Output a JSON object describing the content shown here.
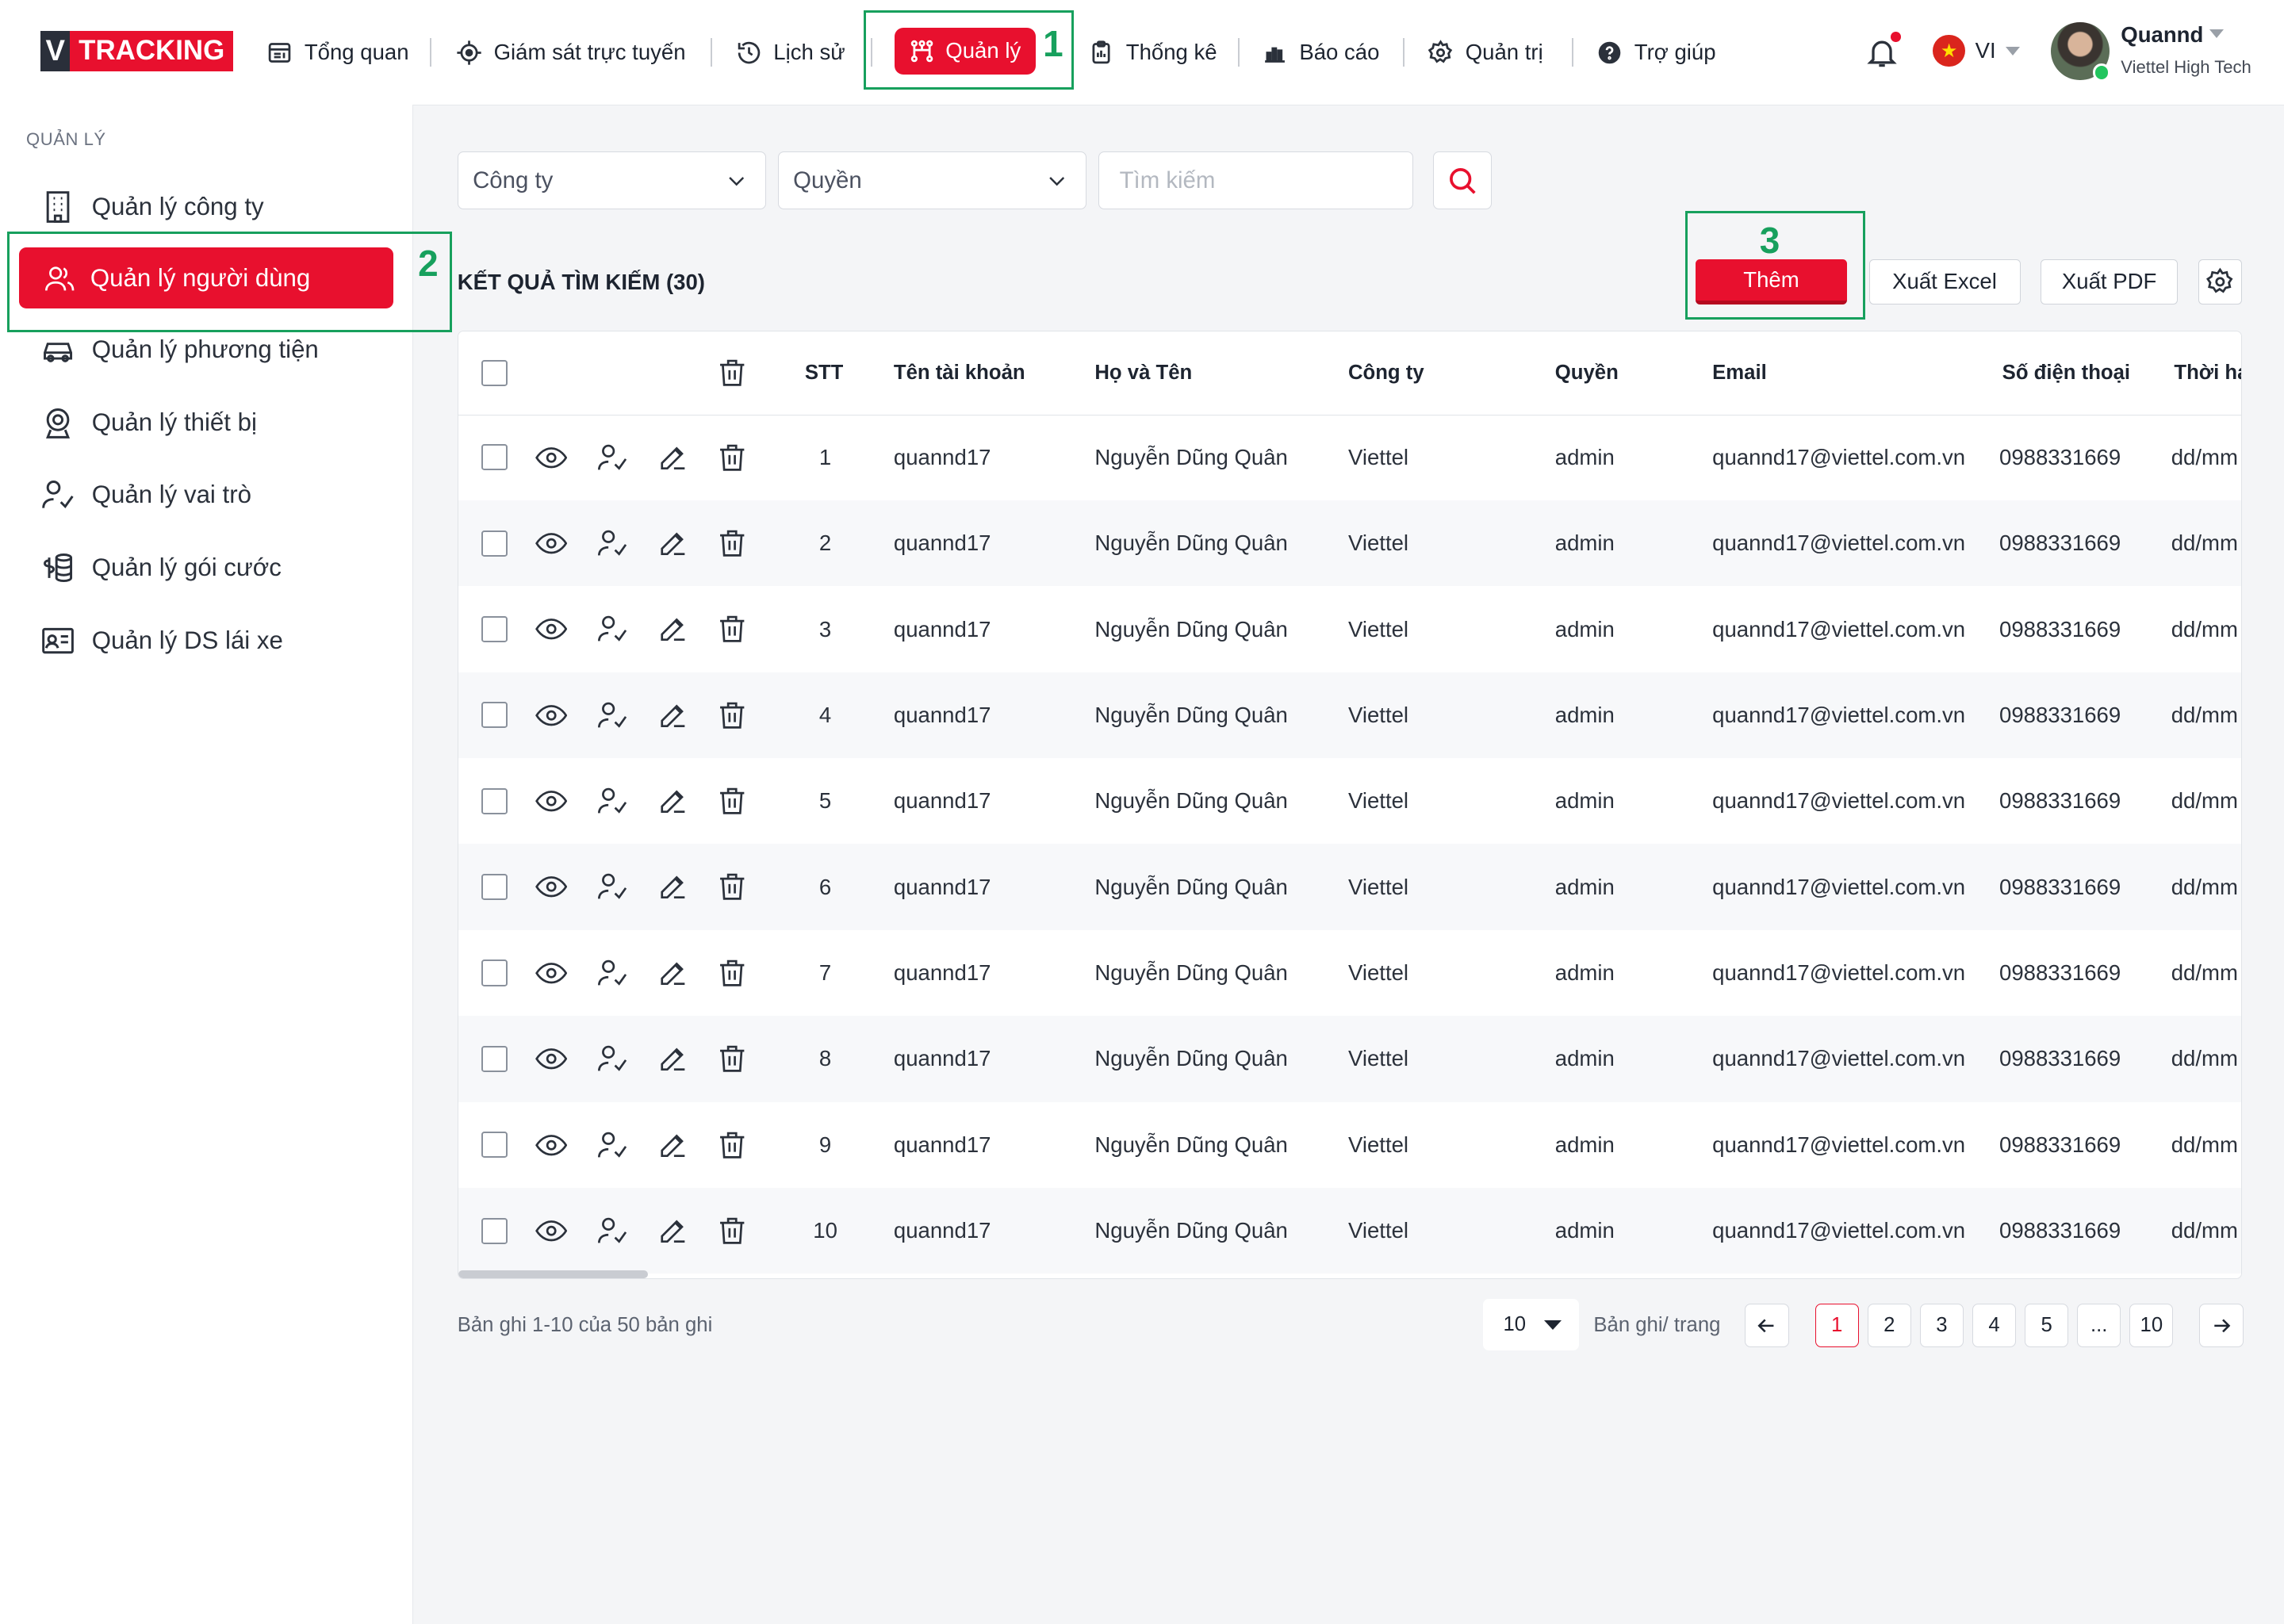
{
  "logo": {
    "v": "V",
    "text": "TRACKING"
  },
  "nav": {
    "items": [
      {
        "label": "Tổng quan",
        "icon": "dashboard-icon"
      },
      {
        "label": "Giám sát trực tuyến",
        "icon": "crosshair-icon"
      },
      {
        "label": "Lịch sử",
        "icon": "history-icon"
      },
      {
        "label": "Quản lý",
        "icon": "management-icon",
        "active": true
      },
      {
        "label": "Thống kê",
        "icon": "clipboard-icon"
      },
      {
        "label": "Báo cáo",
        "icon": "bar-chart-icon"
      },
      {
        "label": "Quản trị",
        "icon": "gear-icon"
      },
      {
        "label": "Trợ giúp",
        "icon": "help-icon"
      }
    ]
  },
  "annotations": [
    "1",
    "2",
    "3"
  ],
  "header": {
    "language": "VI",
    "user_name": "Quannd",
    "user_org": "Viettel High Tech"
  },
  "sidebar": {
    "section_title": "QUẢN LÝ",
    "items": [
      {
        "label": "Quản lý công ty",
        "icon": "building-icon"
      },
      {
        "label": "Quản lý người dùng",
        "icon": "users-icon",
        "active": true
      },
      {
        "label": "Quản lý phương tiện",
        "icon": "car-icon"
      },
      {
        "label": "Quản lý thiết bị",
        "icon": "device-icon"
      },
      {
        "label": "Quản lý vai trò",
        "icon": "user-check-icon"
      },
      {
        "label": "Quản lý gói cước",
        "icon": "coins-icon"
      },
      {
        "label": "Quản lý DS lái xe",
        "icon": "id-card-icon"
      }
    ]
  },
  "filters": {
    "company": "Công ty",
    "role": "Quyền",
    "search_placeholder": "Tìm kiếm"
  },
  "results": {
    "title": "KẾT QUẢ TÌM KIẾM (30)"
  },
  "actions": {
    "add": "Thêm",
    "export_excel": "Xuất Excel",
    "export_pdf": "Xuất PDF"
  },
  "table": {
    "columns": [
      "STT",
      "Tên tài khoản",
      "Họ và Tên",
      "Công ty",
      "Quyền",
      "Email",
      "Số điện thoại",
      "Thời hạn"
    ],
    "rows": [
      [
        "1",
        "quannd17",
        "Nguyễn Dũng Quân",
        "Viettel",
        "admin",
        "quannd17@viettel.com.vn",
        "0988331669",
        "dd/mm"
      ],
      [
        "2",
        "quannd17",
        "Nguyễn Dũng Quân",
        "Viettel",
        "admin",
        "quannd17@viettel.com.vn",
        "0988331669",
        "dd/mm"
      ],
      [
        "3",
        "quannd17",
        "Nguyễn Dũng Quân",
        "Viettel",
        "admin",
        "quannd17@viettel.com.vn",
        "0988331669",
        "dd/mm"
      ],
      [
        "4",
        "quannd17",
        "Nguyễn Dũng Quân",
        "Viettel",
        "admin",
        "quannd17@viettel.com.vn",
        "0988331669",
        "dd/mm"
      ],
      [
        "5",
        "quannd17",
        "Nguyễn Dũng Quân",
        "Viettel",
        "admin",
        "quannd17@viettel.com.vn",
        "0988331669",
        "dd/mm"
      ],
      [
        "6",
        "quannd17",
        "Nguyễn Dũng Quân",
        "Viettel",
        "admin",
        "quannd17@viettel.com.vn",
        "0988331669",
        "dd/mm"
      ],
      [
        "7",
        "quannd17",
        "Nguyễn Dũng Quân",
        "Viettel",
        "admin",
        "quannd17@viettel.com.vn",
        "0988331669",
        "dd/mm"
      ],
      [
        "8",
        "quannd17",
        "Nguyễn Dũng Quân",
        "Viettel",
        "admin",
        "quannd17@viettel.com.vn",
        "0988331669",
        "dd/mm"
      ],
      [
        "9",
        "quannd17",
        "Nguyễn Dũng Quân",
        "Viettel",
        "admin",
        "quannd17@viettel.com.vn",
        "0988331669",
        "dd/mm"
      ],
      [
        "10",
        "quannd17",
        "Nguyễn Dũng Quân",
        "Viettel",
        "admin",
        "quannd17@viettel.com.vn",
        "0988331669",
        "dd/mm"
      ]
    ],
    "row_actions": [
      "view-icon",
      "assign-role-icon",
      "edit-icon",
      "delete-icon"
    ]
  },
  "pagination": {
    "range_text": "Bản ghi 1-10 của 50 bản ghi",
    "page_size": "10",
    "per_page_label": "Bản ghi/ trang",
    "pages": [
      "1",
      "2",
      "3",
      "4",
      "5",
      "...",
      "10"
    ],
    "current": "1"
  },
  "colors": {
    "brand": "#e8102e",
    "annotation": "#17a05d",
    "sidebar_bg": "#ffffff",
    "content_bg": "#f4f5f7"
  }
}
